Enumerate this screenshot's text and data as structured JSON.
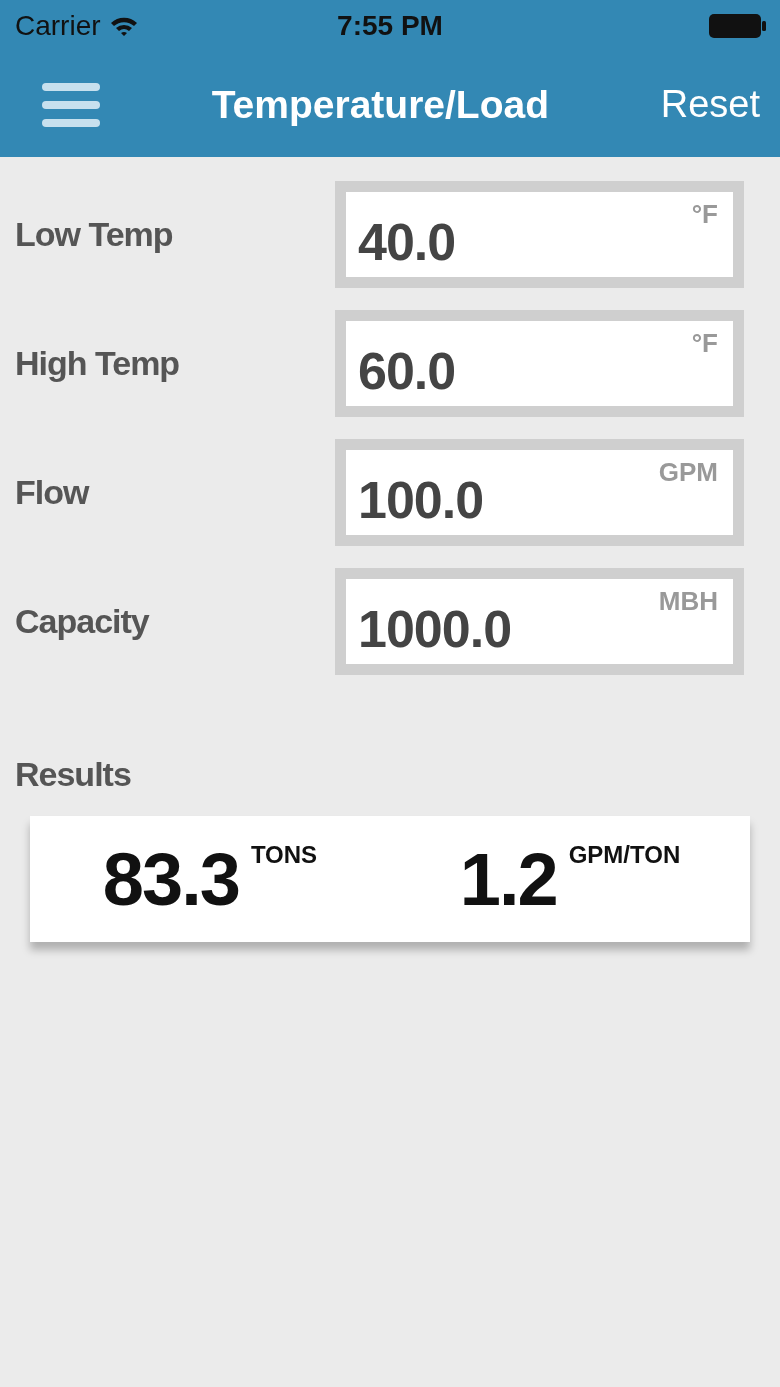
{
  "status_bar": {
    "carrier": "Carrier",
    "time": "7:55 PM"
  },
  "nav": {
    "title": "Temperature/Load",
    "action": "Reset"
  },
  "inputs": [
    {
      "label": "Low Temp",
      "value": "40.0",
      "unit": "°F"
    },
    {
      "label": "High Temp",
      "value": "60.0",
      "unit": "°F"
    },
    {
      "label": "Flow",
      "value": "100.0",
      "unit": "GPM"
    },
    {
      "label": "Capacity",
      "value": "1000.0",
      "unit": "MBH"
    }
  ],
  "results": {
    "title": "Results",
    "items": [
      {
        "value": "83.3",
        "unit": "TONS"
      },
      {
        "value": "1.2",
        "unit": "GPM/TON"
      }
    ]
  }
}
